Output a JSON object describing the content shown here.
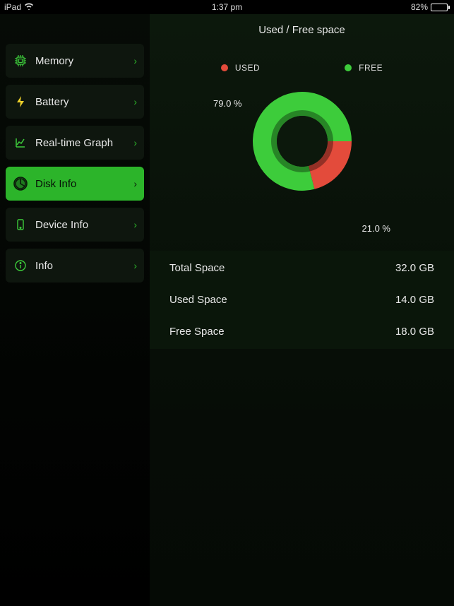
{
  "status": {
    "device": "iPad",
    "time": "1:37 pm",
    "battery_pct": "82%"
  },
  "header": {
    "title": "Used / Free space"
  },
  "sidebar": {
    "items": [
      {
        "label": "Memory"
      },
      {
        "label": "Battery"
      },
      {
        "label": "Real-time Graph"
      },
      {
        "label": "Disk Info"
      },
      {
        "label": "Device Info"
      },
      {
        "label": "Info"
      }
    ],
    "active_index": 3
  },
  "legend": {
    "used": "USED",
    "free": "FREE"
  },
  "chart_data": {
    "type": "pie",
    "title": "Used / Free space",
    "series": [
      {
        "name": "FREE",
        "value": 79.0,
        "color": "#3dcc3b",
        "label": "79.0 %"
      },
      {
        "name": "USED",
        "value": 21.0,
        "color": "#e34b3b",
        "label": "21.0 %"
      }
    ],
    "donut": true
  },
  "stats": {
    "rows": [
      {
        "label": "Total Space",
        "value": "32.0 GB"
      },
      {
        "label": "Used Space",
        "value": "14.0 GB"
      },
      {
        "label": "Free Space",
        "value": "18.0 GB"
      }
    ]
  }
}
